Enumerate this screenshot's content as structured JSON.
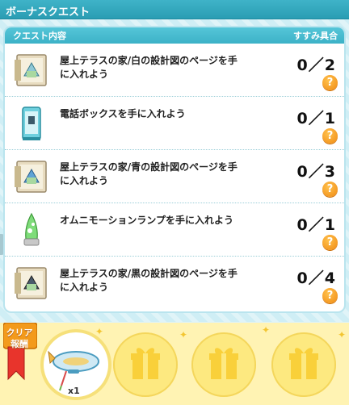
{
  "window": {
    "title": "ボーナスクエスト"
  },
  "panel": {
    "header_left": "クエスト内容",
    "header_right": "すすみ具合"
  },
  "quests": [
    {
      "text": "屋上テラスの家/白の設計図のページを手に入れよう",
      "progress": "0／2",
      "icon": "blueprint-icon"
    },
    {
      "text": "電話ボックスを手に入れよう",
      "progress": "0／1",
      "icon": "phone-booth-icon"
    },
    {
      "text": "屋上テラスの家/青の設計図のページを手に入れよう",
      "progress": "0／3",
      "icon": "blueprint-icon"
    },
    {
      "text": "オムニモーションランプを手に入れよう",
      "progress": "0／1",
      "icon": "lava-lamp-icon"
    },
    {
      "text": "屋上テラスの家/黒の設計図のページを手に入れよう",
      "progress": "0／4",
      "icon": "blueprint-icon"
    }
  ],
  "help_label": "?",
  "reward": {
    "ribbon_label": "クリア報酬",
    "item_icon": "blimp-icon",
    "item_count": "x1",
    "empty_slot_icon": "gift-box-icon"
  },
  "colors": {
    "accent": "#3cb2c7",
    "help": "#f08a12",
    "ribbon": "#e8342c",
    "reward_bg": "#fff3b3"
  }
}
